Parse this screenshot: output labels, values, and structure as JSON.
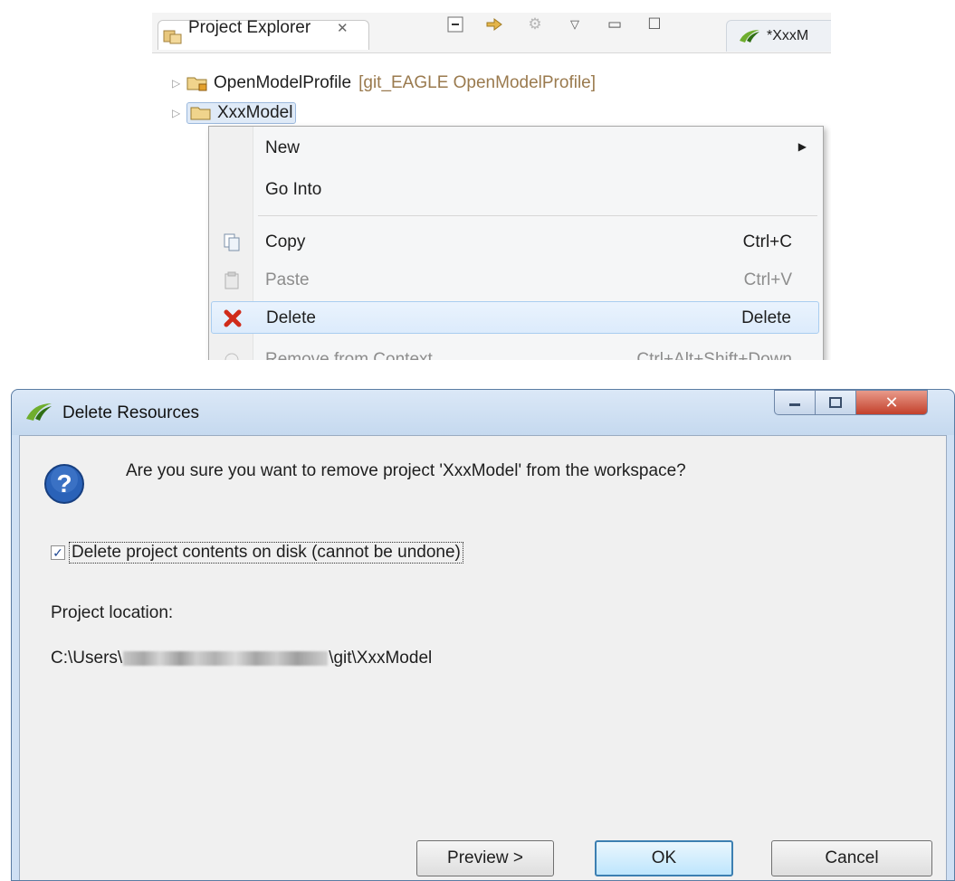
{
  "explorer": {
    "tab_title": "Project Explorer",
    "editor_tab_label": "*XxxM",
    "tree": [
      {
        "label": "OpenModelProfile",
        "decoration": "[git_EAGLE OpenModelProfile]"
      },
      {
        "label": "XxxModel"
      }
    ]
  },
  "context_menu": {
    "items": [
      {
        "label": "New",
        "shortcut": ""
      },
      {
        "label": "Go Into",
        "shortcut": ""
      },
      {
        "label": "Copy",
        "shortcut": "Ctrl+C"
      },
      {
        "label": "Paste",
        "shortcut": "Ctrl+V"
      },
      {
        "label": "Delete",
        "shortcut": "Delete"
      },
      {
        "label": "Remove from Context",
        "shortcut": "Ctrl+Alt+Shift+Down"
      }
    ]
  },
  "dialog": {
    "title": "Delete Resources",
    "question": "Are you sure you want to remove project 'XxxModel' from the workspace?",
    "checkbox_label": "Delete project contents on disk (cannot be undone)",
    "checkbox_checked": true,
    "location_label": "Project location:",
    "location_prefix": "C:\\Users\\",
    "location_suffix": "\\git\\XxxModel",
    "buttons": {
      "preview": "Preview >",
      "ok": "OK",
      "cancel": "Cancel"
    }
  },
  "colors": {
    "menu_highlight": "#dcebfc",
    "dialog_frame": "#cfe0f4",
    "close_button": "#c3402b",
    "ok_button_border": "#3c7fb1"
  }
}
